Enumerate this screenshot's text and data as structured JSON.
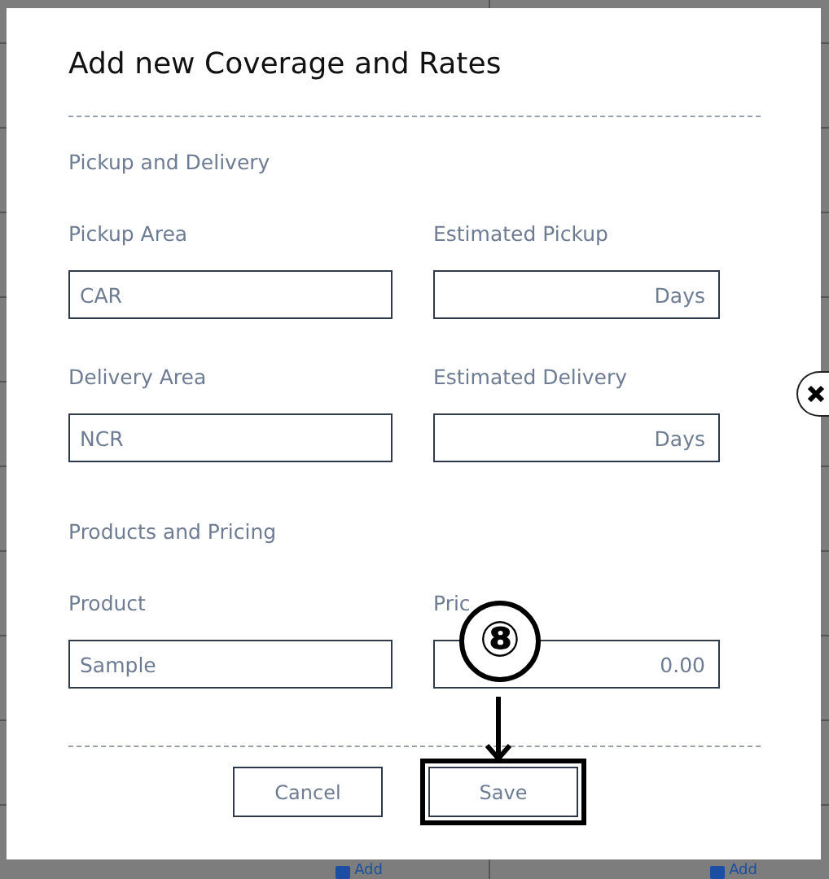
{
  "dialog": {
    "title": "Add new Coverage and Rates",
    "sections": [
      {
        "heading": "Pickup and Delivery",
        "rows": [
          [
            {
              "label": "Pickup Area",
              "kind": "text",
              "value": "CAR"
            },
            {
              "label": "Estimated Pickup",
              "kind": "suffix",
              "suffix": "Days"
            }
          ],
          [
            {
              "label": "Delivery Area",
              "kind": "text",
              "value": "NCR"
            },
            {
              "label": "Estimated Delivery",
              "kind": "suffix",
              "suffix": "Days"
            }
          ]
        ]
      },
      {
        "heading": "Products and Pricing",
        "rows": [
          [
            {
              "label": "Product",
              "kind": "text",
              "value": "Sample"
            },
            {
              "label": "Pric",
              "kind": "amount",
              "value": "0.00"
            }
          ]
        ]
      }
    ],
    "buttons": [
      {
        "label": "Cancel",
        "highlighted": false
      },
      {
        "label": "Save",
        "highlighted": true
      }
    ]
  },
  "annotation": {
    "marker": "⑧"
  },
  "background": {
    "links": [
      "Add",
      "Add"
    ]
  }
}
